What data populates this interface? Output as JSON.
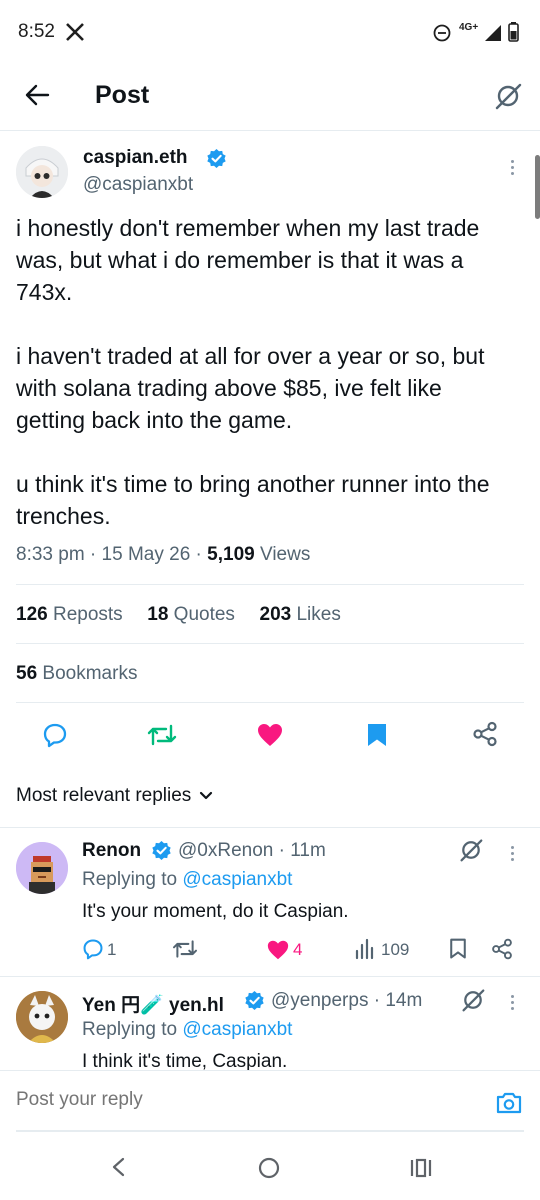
{
  "status_bar": {
    "time": "8:52",
    "network": "4G+"
  },
  "header": {
    "title": "Post"
  },
  "post": {
    "display_name": "caspian.eth",
    "handle": "@caspianxbt",
    "text": "i honestly don't remember when my last trade was, but what i do remember is that it was a 743x.\n\ni haven't traded at all for over a year or so, but with solana trading above $85, ive felt like getting back into the game.\n\nu think it's time to bring another runner into the trenches.",
    "time": "8:33 pm",
    "date": "15 May 26",
    "views_count": "5,109",
    "views_label": "Views",
    "reposts_count": "126",
    "reposts_label": "Reposts",
    "quotes_count": "18",
    "quotes_label": "Quotes",
    "likes_count": "203",
    "likes_label": "Likes",
    "bookmarks_count": "56",
    "bookmarks_label": "Bookmarks"
  },
  "replies_sort": {
    "label": "Most relevant replies"
  },
  "replies": [
    {
      "display_name": "Renon",
      "handle": "@0xRenon",
      "age": "11m",
      "replying_prefix": "Replying to",
      "replying_to": "@caspianxbt",
      "text": "It's your moment, do it Caspian.",
      "reply_count": "1",
      "like_count": "4",
      "view_count": "109"
    },
    {
      "display_name": "Yen 円🧪 yen.hl",
      "handle": "@yenperps",
      "age": "14m",
      "replying_prefix": "Replying to",
      "replying_to": "@caspianxbt",
      "text": "I think it's time, Caspian."
    }
  ],
  "composer": {
    "placeholder": "Post your reply"
  },
  "colors": {
    "accent": "#1d9bf0",
    "like": "#f91880",
    "repost": "#00ba7c",
    "text": "#0f1419",
    "muted": "#536471"
  },
  "icons": [
    "x-logo-icon",
    "dnd-icon",
    "signal-icon",
    "battery-icon",
    "back-arrow-icon",
    "grok-icon",
    "verified-badge-icon",
    "more-icon",
    "reply-icon",
    "repost-icon",
    "heart-icon",
    "bookmark-icon",
    "share-icon",
    "chevron-down-icon",
    "views-icon",
    "camera-icon",
    "nav-back-icon",
    "nav-home-icon",
    "nav-recents-icon"
  ]
}
